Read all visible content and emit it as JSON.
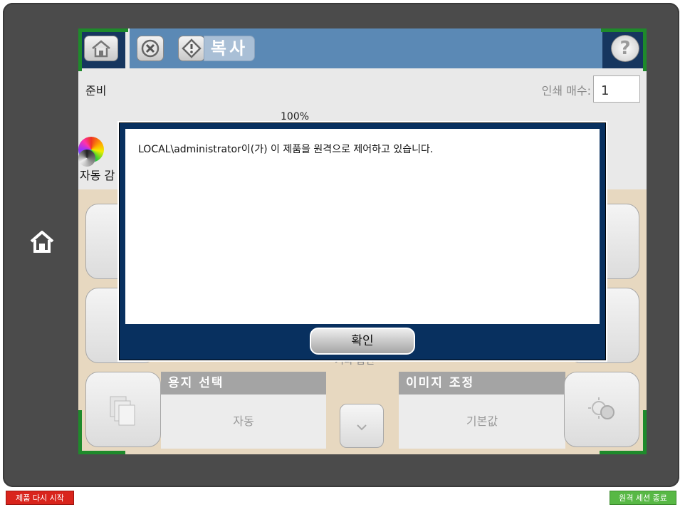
{
  "header": {
    "title": "복사",
    "help_label": "?"
  },
  "status": {
    "state": "준비",
    "copies_label": "인쇄 매수:",
    "copies_value": "1",
    "scale_text": "100%",
    "color_mode_label": "자동 감"
  },
  "options": {
    "paper_select": {
      "label": "용지 선택",
      "value": "자동"
    },
    "image_adjust": {
      "label": "이미지 조정",
      "value": "기본값"
    },
    "more_partial_label": "기타 옵션"
  },
  "dialog": {
    "message": "LOCAL\\administrator이(가) 이 제품을 원격으로 제어하고 있습니다.",
    "ok_label": "확인"
  },
  "bottom": {
    "restart_label": "제품 다시 시작",
    "end_session_label": "원격 세션 종료"
  },
  "colors": {
    "bezel": "#4b4b4b",
    "header_blue": "#5b89b5",
    "header_dark": "#16365f",
    "dialog_frame": "#08305f",
    "panel_beige": "#e7d8c0",
    "corner_green": "#1e8a2b",
    "restart_red": "#d9241c",
    "end_green": "#58b845"
  }
}
